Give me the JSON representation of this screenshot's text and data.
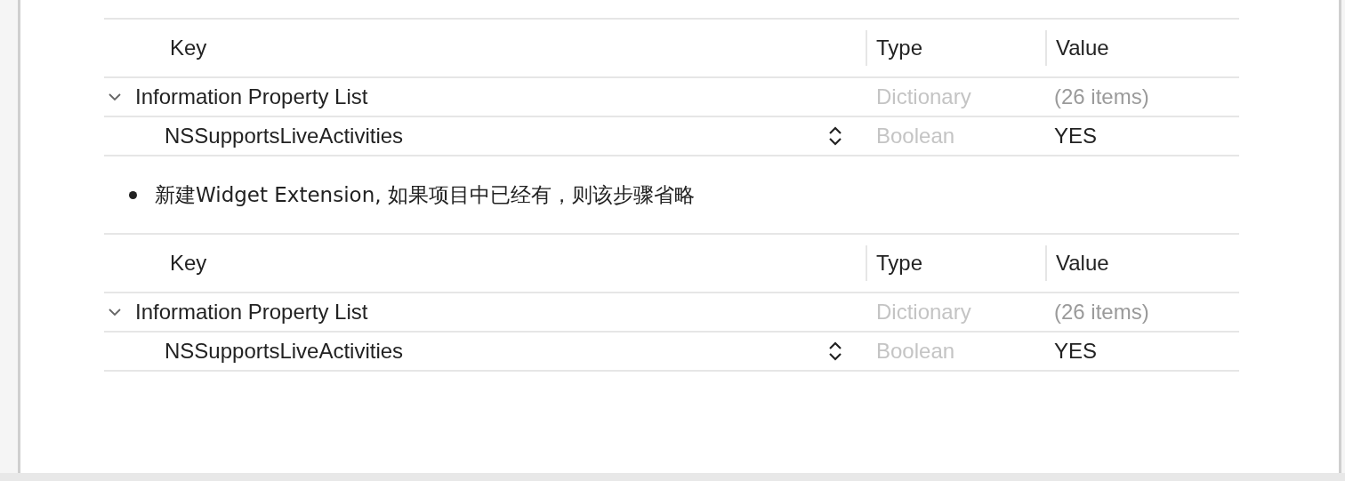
{
  "blocks": [
    {
      "kind": "table",
      "columns": [
        "Key",
        "Type",
        "Value"
      ],
      "rows": [
        {
          "key": "Information Property List",
          "type": "Dictionary",
          "value": "(26 items)",
          "expanded": true,
          "children": [
            {
              "key": "NSSupportsLiveActivities",
              "type": "Boolean",
              "value": "YES"
            }
          ]
        }
      ]
    },
    {
      "kind": "bullet",
      "text": "新建Widget Extension, 如果项目中已经有，则该步骤省略"
    },
    {
      "kind": "table",
      "columns": [
        "Key",
        "Type",
        "Value"
      ],
      "rows": [
        {
          "key": "Information Property List",
          "type": "Dictionary",
          "value": "(26 items)",
          "expanded": true,
          "children": [
            {
              "key": "NSSupportsLiveActivities",
              "type": "Boolean",
              "value": "YES"
            }
          ]
        }
      ]
    }
  ]
}
